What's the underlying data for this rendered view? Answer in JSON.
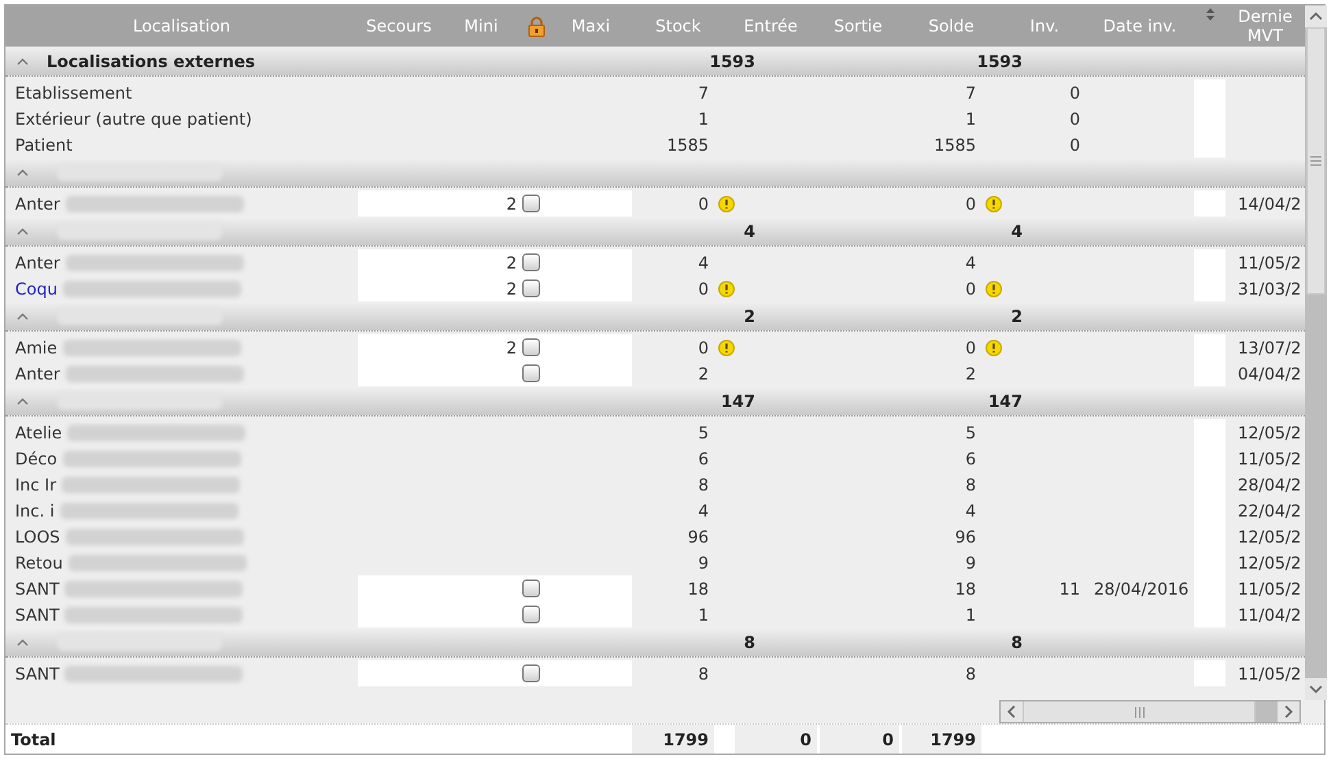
{
  "columns": [
    {
      "label": "Localisation",
      "kind": "text"
    },
    {
      "label": "Secours",
      "kind": "text"
    },
    {
      "label": "Mini",
      "kind": "text"
    },
    {
      "kind": "lock"
    },
    {
      "label": "Maxi",
      "kind": "text"
    },
    {
      "label": "Stock",
      "kind": "text"
    },
    {
      "label": "Entrée",
      "kind": "text"
    },
    {
      "label": "Sortie",
      "kind": "text"
    },
    {
      "label": "Solde",
      "kind": "text"
    },
    {
      "label": "Inv.",
      "kind": "text"
    },
    {
      "label": "Date inv.",
      "kind": "text"
    },
    {
      "kind": "sort"
    },
    {
      "label": "Dernie MVT",
      "kind": "text"
    }
  ],
  "groups": [
    {
      "title": "Localisations externes",
      "redacted": false,
      "expanded": true,
      "stock": "1593",
      "solde": "1593",
      "rows": [
        {
          "name": "Etablissement",
          "redacted": false,
          "link": false,
          "editable": false,
          "stock": "7",
          "solde": "7",
          "inv": "0"
        },
        {
          "name": "Extérieur (autre que patient)",
          "redacted": false,
          "link": false,
          "editable": false,
          "stock": "1",
          "solde": "1",
          "inv": "0"
        },
        {
          "name": "Patient",
          "redacted": false,
          "link": false,
          "editable": false,
          "stock": "1585",
          "solde": "1585",
          "inv": "0"
        }
      ]
    },
    {
      "redacted": true,
      "expanded": true,
      "rows": [
        {
          "name": "Anter",
          "redacted": true,
          "link": false,
          "editable": true,
          "mini": "2",
          "checked": false,
          "stock": "0",
          "stock_warning": true,
          "solde": "0",
          "solde_warning": true,
          "mvt": "14/04/2"
        }
      ]
    },
    {
      "redacted": true,
      "expanded": true,
      "stock": "4",
      "solde": "4",
      "rows": [
        {
          "name": "Anter",
          "redacted": true,
          "link": false,
          "editable": true,
          "mini": "2",
          "checked": false,
          "stock": "4",
          "stock_warning": false,
          "solde": "4",
          "solde_warning": false,
          "mvt": "11/05/2"
        },
        {
          "name": "Coqu",
          "redacted": true,
          "link": true,
          "editable": true,
          "mini": "2",
          "checked": false,
          "stock": "0",
          "stock_warning": true,
          "solde": "0",
          "solde_warning": true,
          "mvt": "31/03/2"
        }
      ]
    },
    {
      "redacted": true,
      "expanded": true,
      "stock": "2",
      "solde": "2",
      "rows": [
        {
          "name": "Amie",
          "redacted": true,
          "link": false,
          "editable": true,
          "mini": "2",
          "checked": false,
          "stock": "0",
          "stock_warning": true,
          "solde": "0",
          "solde_warning": true,
          "mvt": "13/07/2"
        },
        {
          "name": "Anter",
          "redacted": true,
          "link": false,
          "editable": true,
          "checked": false,
          "stock": "2",
          "stock_warning": false,
          "solde": "2",
          "solde_warning": false,
          "mvt": "04/04/2"
        }
      ]
    },
    {
      "redacted": true,
      "expanded": true,
      "stock": "147",
      "solde": "147",
      "rows": [
        {
          "name": "Atelie",
          "redacted": true,
          "link": false,
          "editable": false,
          "stock": "5",
          "solde": "5",
          "mvt": "12/05/2"
        },
        {
          "name": "Déco",
          "redacted": true,
          "link": false,
          "editable": false,
          "stock": "6",
          "solde": "6",
          "mvt": "11/05/2"
        },
        {
          "name": "Inc Ir",
          "redacted": true,
          "link": false,
          "editable": false,
          "stock": "8",
          "solde": "8",
          "mvt": "28/04/2"
        },
        {
          "name": "Inc. i",
          "redacted": true,
          "link": false,
          "editable": false,
          "stock": "4",
          "solde": "4",
          "mvt": "22/04/2"
        },
        {
          "name": "LOOS",
          "redacted": true,
          "link": false,
          "editable": false,
          "stock": "96",
          "solde": "96",
          "mvt": "12/05/2"
        },
        {
          "name": "Retou",
          "redacted": true,
          "link": false,
          "editable": false,
          "stock": "9",
          "solde": "9",
          "mvt": "12/05/2"
        },
        {
          "name": "SANT",
          "redacted": true,
          "link": false,
          "editable": true,
          "checked": false,
          "stock": "18",
          "solde": "18",
          "inv": "11",
          "date_inv": "28/04/2016",
          "mvt": "11/05/2"
        },
        {
          "name": "SANT",
          "redacted": true,
          "link": false,
          "editable": true,
          "checked": false,
          "stock": "1",
          "solde": "1",
          "mvt": "11/04/2"
        }
      ]
    },
    {
      "redacted": true,
      "expanded": true,
      "stock": "8",
      "solde": "8",
      "rows": [
        {
          "name": "SANT",
          "redacted": true,
          "link": false,
          "editable": true,
          "checked": false,
          "stock": "8",
          "solde": "8",
          "mvt": "11/05/2"
        }
      ]
    }
  ],
  "total": {
    "label": "Total",
    "stock": "1799",
    "entree": "0",
    "sortie": "0",
    "solde": "1799"
  }
}
